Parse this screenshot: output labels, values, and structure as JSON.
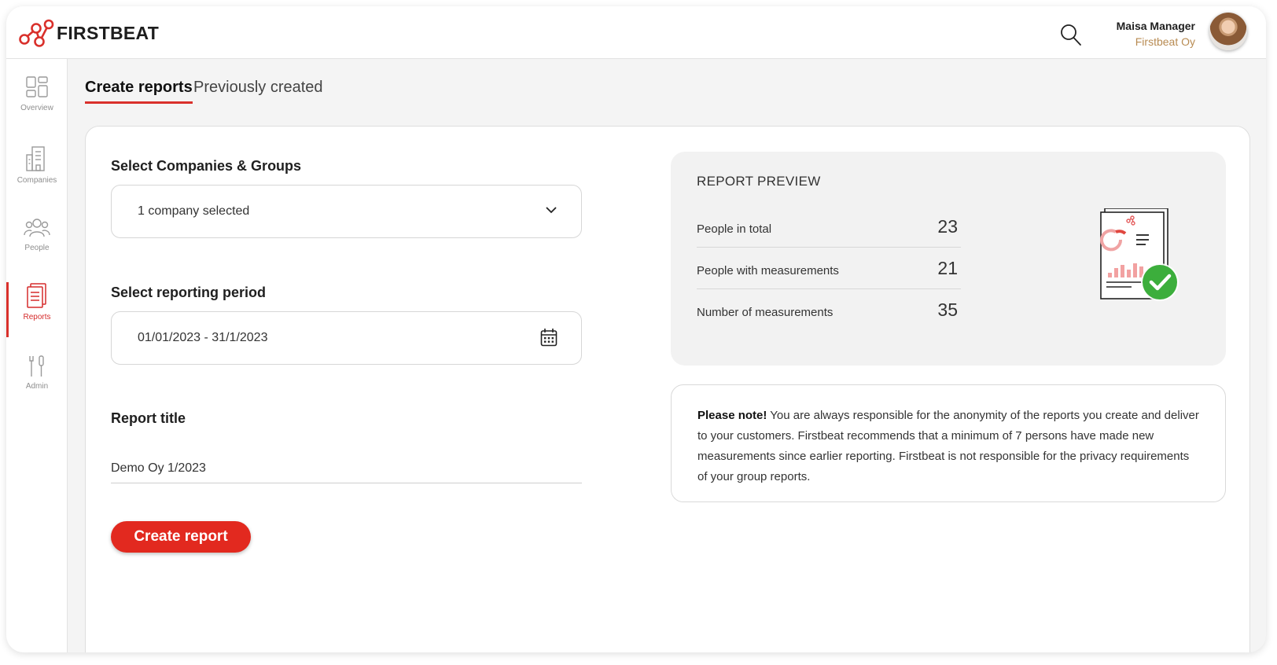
{
  "app": {
    "brand": "FIRSTBEAT",
    "brand_color": "#d9302b"
  },
  "header": {
    "search_icon": "search-icon",
    "user_name": "Maisa Manager",
    "user_company": "Firstbeat Oy"
  },
  "sidebar": {
    "items": [
      {
        "label": "Overview",
        "icon": "dashboard-icon",
        "active": false
      },
      {
        "label": "Companies",
        "icon": "building-icon",
        "active": false
      },
      {
        "label": "People",
        "icon": "people-icon",
        "active": false
      },
      {
        "label": "Reports",
        "icon": "report-icon",
        "active": true
      },
      {
        "label": "Admin",
        "icon": "tools-icon",
        "active": false
      }
    ]
  },
  "tabs": [
    {
      "label": "Create reports",
      "active": true
    },
    {
      "label": "Previously created",
      "active": false
    }
  ],
  "form": {
    "companies_label": "Select Companies & Groups",
    "companies_value": "1 company selected",
    "period_label": "Select reporting period",
    "period_value": "01/01/2023 - 31/1/2023",
    "title_label": "Report title",
    "title_value": "Demo Oy 1/2023",
    "create_button": "Create report"
  },
  "preview": {
    "title": "REPORT PREVIEW",
    "stats": [
      {
        "label": "People in total",
        "value": "23"
      },
      {
        "label": "People with measurements",
        "value": "21"
      },
      {
        "label": "Number of measurements",
        "value": "35"
      }
    ]
  },
  "note": {
    "bold": "Please note!",
    "text": " You are always responsible for the anonymity of the reports you create and deliver to your customers. Firstbeat recommends that a minimum of 7 persons have made new measurements since earlier reporting. Firstbeat is not responsible for the privacy requirements of your group reports."
  }
}
